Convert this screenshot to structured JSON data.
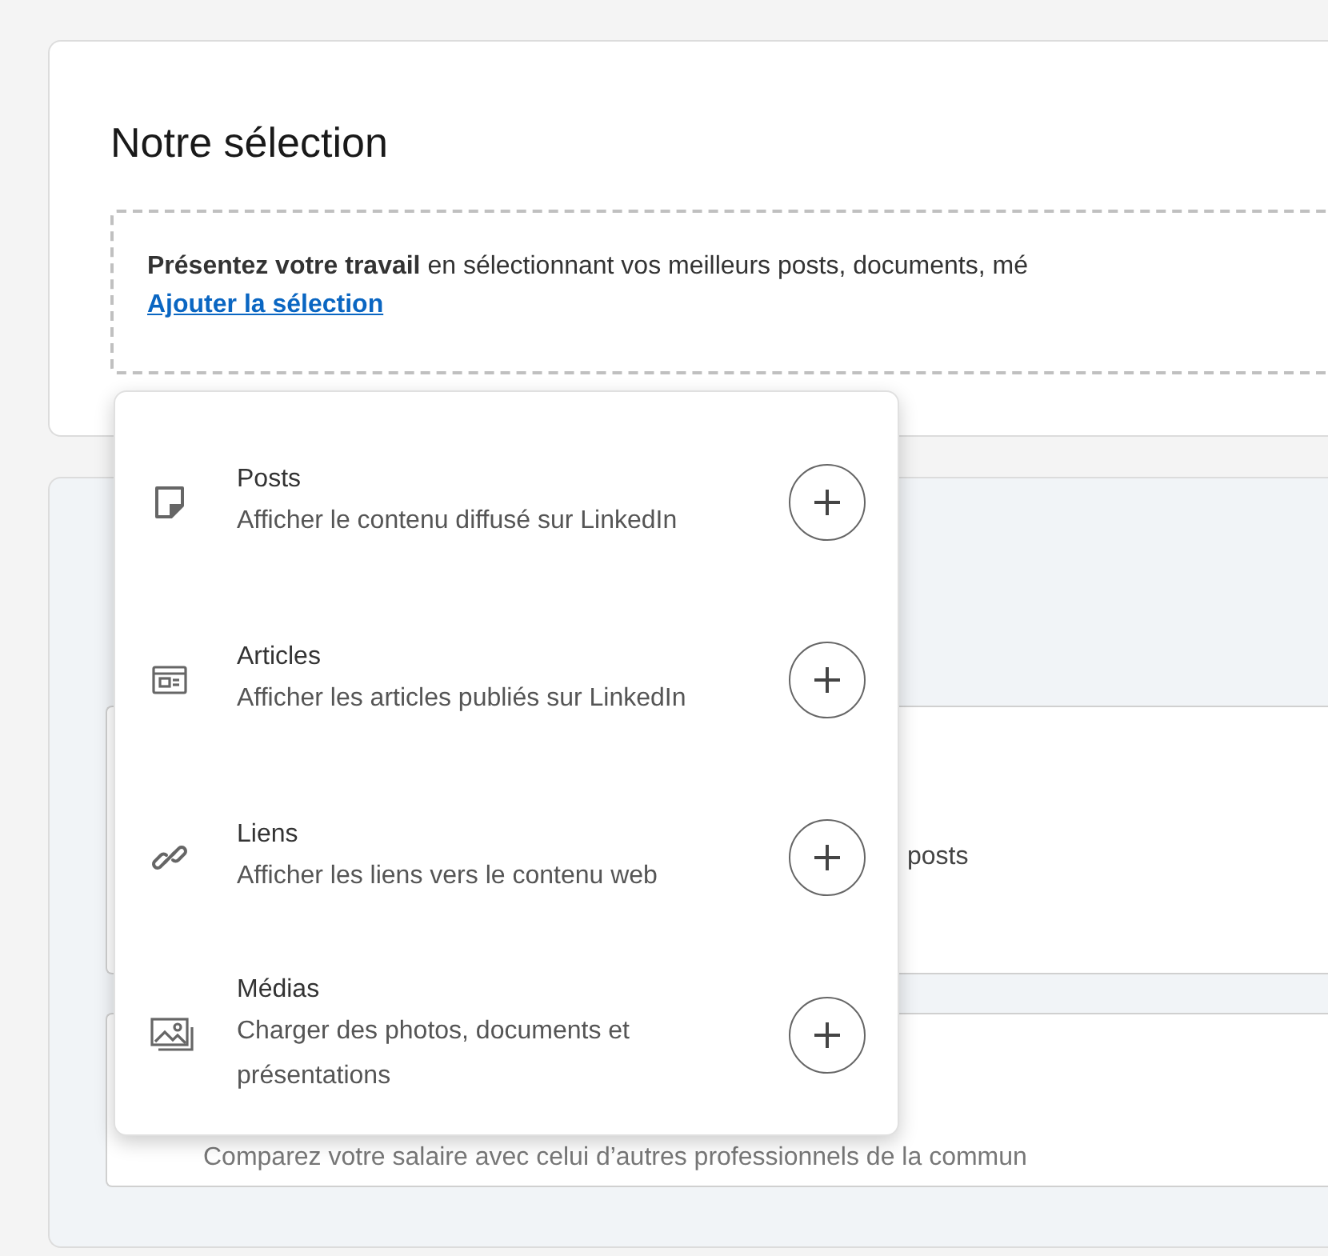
{
  "selection_card": {
    "title": "Notre sélection",
    "intro": "**Présentez votre travail** en sélectionnant vos meilleurs posts, documents, mé",
    "add_link": "Ajouter la sélection"
  },
  "background_section": {
    "card_text": "posts",
    "salary_text": "Comparez votre salaire avec celui d’autres professionnels de la commun"
  },
  "menu": {
    "items": [
      {
        "kind": "posts",
        "title": "Posts",
        "description": "Afficher le contenu diffusé sur LinkedIn"
      },
      {
        "kind": "articles",
        "title": "Articles",
        "description": "Afficher les articles publiés sur LinkedIn"
      },
      {
        "kind": "links",
        "title": "Liens",
        "description": "Afficher les liens vers le contenu web"
      },
      {
        "kind": "media",
        "title": "Médias",
        "description": "Charger des photos, documents et présentations"
      }
    ]
  }
}
